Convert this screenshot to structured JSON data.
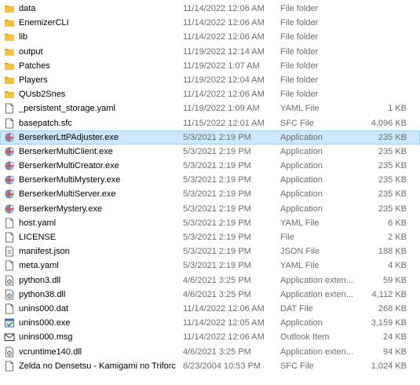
{
  "files": [
    {
      "name": "data",
      "date": "11/14/2022 12:06 AM",
      "type": "File folder",
      "size": "",
      "icon": "folder-icon"
    },
    {
      "name": "EnemizerCLI",
      "date": "11/14/2022 12:06 AM",
      "type": "File folder",
      "size": "",
      "icon": "folder-icon"
    },
    {
      "name": "lib",
      "date": "11/14/2022 12:06 AM",
      "type": "File folder",
      "size": "",
      "icon": "folder-icon"
    },
    {
      "name": "output",
      "date": "11/19/2022 12:14 AM",
      "type": "File folder",
      "size": "",
      "icon": "folder-icon"
    },
    {
      "name": "Patches",
      "date": "11/19/2022 1:07 AM",
      "type": "File folder",
      "size": "",
      "icon": "folder-icon"
    },
    {
      "name": "Players",
      "date": "11/19/2022 12:04 AM",
      "type": "File folder",
      "size": "",
      "icon": "folder-icon"
    },
    {
      "name": "QUsb2Snes",
      "date": "11/14/2022 12:06 AM",
      "type": "File folder",
      "size": "",
      "icon": "folder-icon"
    },
    {
      "name": "_persistent_storage.yaml",
      "date": "11/19/2022 1:09 AM",
      "type": "YAML File",
      "size": "1 KB",
      "icon": "document-icon"
    },
    {
      "name": "basepatch.sfc",
      "date": "11/15/2022 12:01 AM",
      "type": "SFC File",
      "size": "4,096 KB",
      "icon": "document-icon"
    },
    {
      "name": "BerserkerLttPAdjuster.exe",
      "date": "5/3/2021 2:19 PM",
      "type": "Application",
      "size": "235 KB",
      "icon": "application-icon",
      "selected": true
    },
    {
      "name": "BerserkerMultiClient.exe",
      "date": "5/3/2021 2:19 PM",
      "type": "Application",
      "size": "235 KB",
      "icon": "application-icon"
    },
    {
      "name": "BerserkerMultiCreator.exe",
      "date": "5/3/2021 2:19 PM",
      "type": "Application",
      "size": "235 KB",
      "icon": "application-icon"
    },
    {
      "name": "BerserkerMultiMystery.exe",
      "date": "5/3/2021 2:19 PM",
      "type": "Application",
      "size": "235 KB",
      "icon": "application-icon"
    },
    {
      "name": "BerserkerMultiServer.exe",
      "date": "5/3/2021 2:19 PM",
      "type": "Application",
      "size": "235 KB",
      "icon": "application-icon"
    },
    {
      "name": "BerserkerMystery.exe",
      "date": "5/3/2021 2:19 PM",
      "type": "Application",
      "size": "235 KB",
      "icon": "application-icon"
    },
    {
      "name": "host.yaml",
      "date": "5/3/2021 2:19 PM",
      "type": "YAML File",
      "size": "6 KB",
      "icon": "document-icon"
    },
    {
      "name": "LICENSE",
      "date": "5/3/2021 2:19 PM",
      "type": "File",
      "size": "2 KB",
      "icon": "document-icon"
    },
    {
      "name": "manifest.json",
      "date": "5/3/2021 2:19 PM",
      "type": "JSON File",
      "size": "188 KB",
      "icon": "text-document-icon"
    },
    {
      "name": "meta.yaml",
      "date": "5/3/2021 2:19 PM",
      "type": "YAML File",
      "size": "4 KB",
      "icon": "document-icon"
    },
    {
      "name": "python3.dll",
      "date": "4/6/2021 3:25 PM",
      "type": "Application exten...",
      "size": "59 KB",
      "icon": "dll-icon"
    },
    {
      "name": "python38.dll",
      "date": "4/6/2021 3:25 PM",
      "type": "Application exten...",
      "size": "4,112 KB",
      "icon": "dll-icon"
    },
    {
      "name": "unins000.dat",
      "date": "11/14/2022 12:06 AM",
      "type": "DAT File",
      "size": "268 KB",
      "icon": "document-icon"
    },
    {
      "name": "unins000.exe",
      "date": "11/14/2022 12:05 AM",
      "type": "Application",
      "size": "3,159 KB",
      "icon": "installer-icon"
    },
    {
      "name": "unins000.msg",
      "date": "11/14/2022 12:06 AM",
      "type": "Outlook Item",
      "size": "24 KB",
      "icon": "mail-icon"
    },
    {
      "name": "vcruntime140.dll",
      "date": "4/6/2021 3:25 PM",
      "type": "Application exten...",
      "size": "94 KB",
      "icon": "dll-icon"
    },
    {
      "name": "Zelda no Densetsu - Kamigami no Triforc...",
      "date": "8/23/2004 10:53 PM",
      "type": "SFC File",
      "size": "1,024 KB",
      "icon": "document-icon"
    }
  ],
  "colors": {
    "folder": "#f4c342",
    "folder_dark": "#dba524",
    "selection": "#cce8ff",
    "selection_border": "#99d1ff",
    "secondary_text": "#6d6d6d"
  }
}
